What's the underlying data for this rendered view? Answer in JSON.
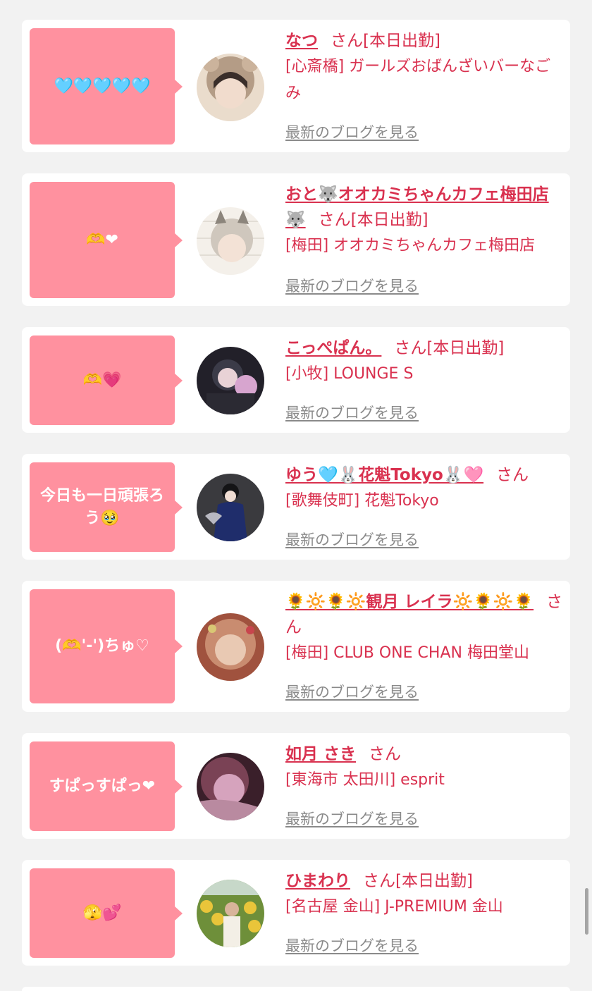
{
  "blog_link_label": "最新のブログを見る",
  "cards": [
    {
      "bubble": "🩵🩵🩵🩵🩵",
      "name": "なつ",
      "suffix": "さん[本日出勤]",
      "shop": "[心斎橋] ガールズおばんざいバーなごみ",
      "avatar_colors": [
        "#eadccc",
        "#b49c86",
        "#3a2e2a"
      ]
    },
    {
      "bubble": "🫶❤",
      "name": "おと🐺オオカミちゃんカフェ梅田店🐺",
      "suffix": "さん[本日出勤]",
      "shop": "[梅田] オオカミちゃんカフェ梅田店",
      "avatar_colors": [
        "#f4f0ea",
        "#cfc7bd",
        "#8c857c"
      ]
    },
    {
      "bubble": "🫶💗",
      "name": "こっぺぱん。",
      "suffix": "さん[本日出勤]",
      "shop": "[小牧] LOUNGE S",
      "avatar_colors": [
        "#3b3b48",
        "#222029",
        "#d7a5cf"
      ]
    },
    {
      "bubble": "今日も一日頑張ろう🥹",
      "name": "ゆう🩵🐰花魁Tokyo🐰🩷",
      "suffix": "さん",
      "shop": "[歌舞伎町] 花魁Tokyo",
      "avatar_colors": [
        "#3a3a3e",
        "#1f2d6b",
        "#b9b9c2"
      ]
    },
    {
      "bubble": "(🫶'-')ちゅ♡",
      "name": "🌻🔆🌻🔆観月 レイラ🔆🌻🔆🌻",
      "suffix": "さん",
      "shop": "[梅田] CLUB ONE CHAN 梅田堂山",
      "avatar_colors": [
        "#c98c70",
        "#a0523e",
        "#e9c9b3"
      ]
    },
    {
      "bubble": "すぱっすぱっ❤",
      "name": "如月 さき",
      "suffix": "さん",
      "shop": "[東海市 太田川] esprit",
      "avatar_colors": [
        "#d6a3bd",
        "#7a4255",
        "#3a1f2a"
      ]
    },
    {
      "bubble": "🫣💕",
      "name": "ひまわり",
      "suffix": "さん[本日出勤]",
      "shop": "[名古屋 金山] J-PREMIUM 金山",
      "avatar_colors": [
        "#e9c53a",
        "#6e8f3a",
        "#f3efe6"
      ]
    }
  ]
}
